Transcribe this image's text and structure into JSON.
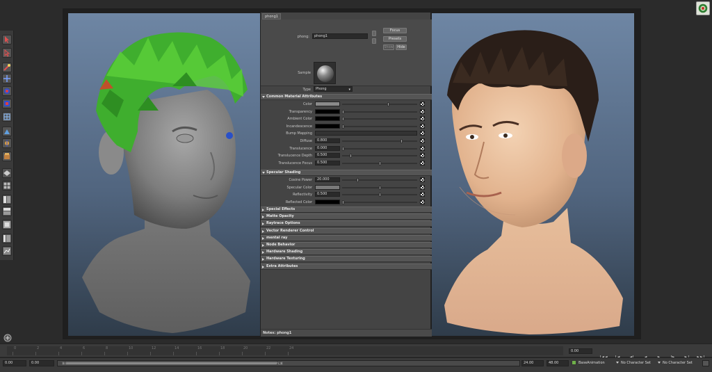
{
  "attribute_editor": {
    "tab": "phong1",
    "material_label": "phong:",
    "material_name": "phong1",
    "buttons": {
      "focus": "Focus",
      "presets": "Presets",
      "show": "Show",
      "hide": "Hide"
    },
    "sample_label": "Sample",
    "type_label": "Type",
    "type_value": "Phong",
    "sections": {
      "common": "Common Material Attributes",
      "specular": "Specular Shading",
      "collapsed": [
        "Special Effects",
        "Matte Opacity",
        "Raytrace Options",
        "Vector Renderer Control",
        "mental ray",
        "Node Behavior",
        "Hardware Shading",
        "Hardware Texturing",
        "Extra Attributes"
      ]
    },
    "common_rows": [
      {
        "label": "Color",
        "kind": "swatch",
        "color": "#8a8a8a",
        "value": "",
        "slider": 0.62
      },
      {
        "label": "Transparency",
        "kind": "swatch",
        "color": "#000000",
        "value": "",
        "slider": 0.0
      },
      {
        "label": "Ambient Color",
        "kind": "swatch",
        "color": "#000000",
        "value": "",
        "slider": 0.0
      },
      {
        "label": "Incandescence",
        "kind": "swatch",
        "color": "#000000",
        "value": "",
        "slider": 0.0
      },
      {
        "label": "Bump Mapping",
        "kind": "wide",
        "color": "",
        "value": "",
        "slider": 0
      },
      {
        "label": "Diffuse",
        "kind": "num",
        "color": "",
        "value": "0.800",
        "slider": 0.8
      },
      {
        "label": "Translucence",
        "kind": "num",
        "color": "",
        "value": "0.000",
        "slider": 0.0
      },
      {
        "label": "Translucence Depth",
        "kind": "num",
        "color": "",
        "value": "0.500",
        "slider": 0.1
      },
      {
        "label": "Translucence Focus",
        "kind": "num",
        "color": "",
        "value": "0.500",
        "slider": 0.5
      }
    ],
    "specular_rows": [
      {
        "label": "Cosine Power",
        "kind": "num",
        "color": "",
        "value": "20.000",
        "slider": 0.2
      },
      {
        "label": "Specular Color",
        "kind": "swatch",
        "color": "#7a7a7a",
        "value": "",
        "slider": 0.5
      },
      {
        "label": "Reflectivity",
        "kind": "num",
        "color": "",
        "value": "0.500",
        "slider": 0.5
      },
      {
        "label": "Reflected Color",
        "kind": "swatch",
        "color": "#000000",
        "value": "",
        "slider": 0.0
      }
    ],
    "notes": "Notes:  phong1"
  },
  "time_slider": {
    "ticks": [
      "0",
      "2",
      "4",
      "6",
      "8",
      "10",
      "12",
      "14",
      "16",
      "18",
      "20",
      "22",
      "24"
    ],
    "current_frame": "0.00",
    "playback": [
      "|◀◀",
      "|◀",
      "◀|",
      "◀",
      "▶",
      "|▶",
      "▶|",
      "▶▶|"
    ]
  },
  "range_bar": {
    "start": "0.00",
    "anim_start": "0.00",
    "range_start": "0",
    "range_end": "24",
    "anim_end": "24.00",
    "end": "48.00",
    "layer": "BaseAnimation",
    "charset1": "No Character Set",
    "charset2": "No Character Set"
  },
  "colors": {
    "hair_green": "#3fae2e",
    "skin": "#e9c2a0",
    "grey_head": "#8c8c8c",
    "hair_dark": "#2a1e18"
  }
}
